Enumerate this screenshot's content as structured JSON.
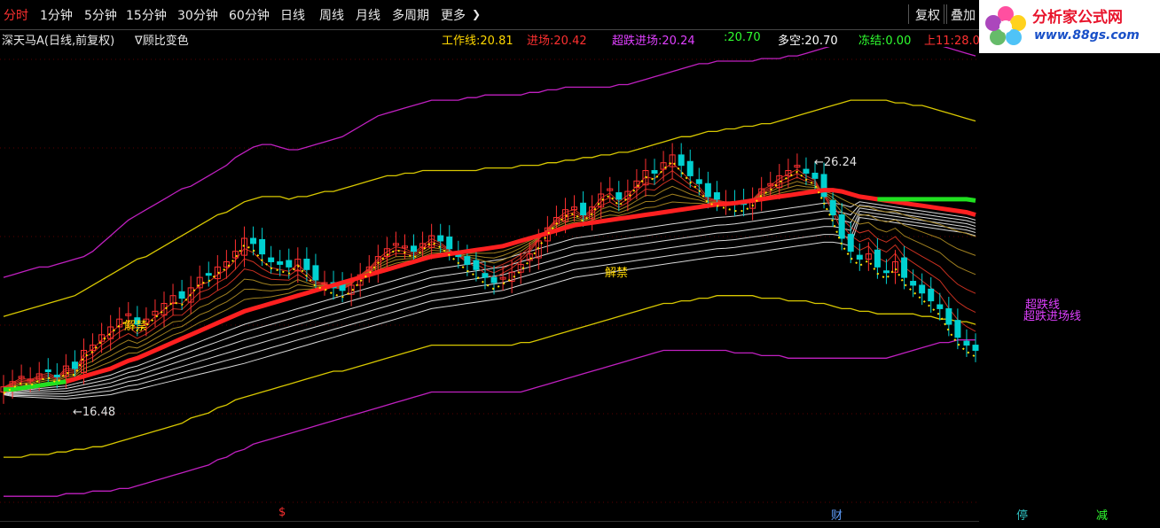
{
  "toolbar": {
    "tabs": [
      "分时",
      "1分钟",
      "5分钟",
      "15分钟",
      "30分钟",
      "60分钟",
      "日线",
      "周线",
      "月线",
      "多周期",
      "更多"
    ],
    "active_tab": "分时",
    "more_arrow": "❯",
    "right_buttons": [
      "复权",
      "叠加"
    ]
  },
  "logo": {
    "name": "分析家公式网",
    "url": "www.88gs.com"
  },
  "info": {
    "stock_title": "深天马A(日线,前复权)",
    "formula": "∇顾比变色",
    "items": [
      {
        "label": "工作线:",
        "value": "20.81",
        "color": "#ffd700"
      },
      {
        "label": "进场:",
        "value": "20.42",
        "color": "#ff3030"
      },
      {
        "label": "超跌进场:",
        "value": "20.24",
        "color": "#e040ff"
      },
      {
        "label": ":",
        "value": "20.70",
        "color": "#30ff30"
      },
      {
        "label": "多空:",
        "value": "20.70",
        "color": "#ffffff"
      },
      {
        "label": "冻结:",
        "value": "0.00",
        "color": "#30ff30"
      },
      {
        "label": "上11:",
        "value": "28.0",
        "color": "#ff3030"
      }
    ]
  },
  "annotations": {
    "high_label": "26.24",
    "low_label": "16.48",
    "jiejin_1": "解禁",
    "jiejin_2": "解禁",
    "chaodie_1": "超跌线",
    "chaodie_2": "超跌进场线"
  },
  "bottom_markers": [
    {
      "text": "$",
      "color": "#ff3030"
    },
    {
      "text": "财",
      "color": "#60a0ff"
    },
    {
      "text": "停",
      "color": "#30c0c0"
    },
    {
      "text": "减",
      "color": "#30ff30"
    }
  ],
  "footer": {
    "text": ""
  },
  "chart_data": {
    "type": "line",
    "note_colors": {
      "up": "#ff3030",
      "down": "#00d0d0",
      "work": "#ff2020",
      "green": "#20e020",
      "band_outer": "#c020c0",
      "band_inner": "#d8c800"
    },
    "ylim": [
      12.5,
      29.5
    ],
    "x": [
      0,
      1,
      2,
      3,
      4,
      5,
      6,
      7,
      8,
      9,
      10,
      11,
      12,
      13,
      14,
      15,
      16,
      17,
      18,
      19,
      20,
      21,
      22,
      23,
      24,
      25,
      26,
      27,
      28,
      29,
      30,
      31,
      32,
      33,
      34,
      35,
      36,
      37,
      38,
      39,
      40,
      41,
      42,
      43,
      44,
      45,
      46,
      47,
      48,
      49,
      50,
      51,
      52,
      53,
      54,
      55,
      56,
      57,
      58,
      59,
      60,
      61,
      62,
      63,
      64,
      65,
      66,
      67,
      68,
      69,
      70,
      71,
      72,
      73,
      74,
      75,
      76,
      77,
      78,
      79,
      80,
      81,
      82,
      83,
      84,
      85,
      86,
      87,
      88,
      89,
      90,
      91,
      92,
      93,
      94,
      95,
      96,
      97,
      98,
      99,
      100,
      101,
      102,
      103,
      104,
      105,
      106,
      107,
      108,
      109
    ],
    "series": [
      {
        "name": "close",
        "values": [
          17.0,
          17.2,
          17.4,
          17.3,
          17.5,
          17.6,
          17.4,
          17.8,
          17.7,
          18.4,
          18.6,
          19.0,
          19.3,
          19.6,
          19.8,
          19.4,
          19.6,
          19.9,
          20.2,
          20.5,
          20.4,
          20.8,
          21.2,
          21.3,
          21.6,
          21.8,
          22.2,
          22.7,
          22.5,
          22.1,
          21.8,
          21.7,
          21.6,
          21.9,
          21.5,
          21.1,
          21.0,
          20.8,
          20.7,
          20.9,
          21.3,
          21.6,
          22.0,
          22.3,
          22.5,
          22.4,
          22.2,
          22.5,
          22.8,
          22.6,
          22.3,
          22.0,
          21.7,
          21.5,
          21.2,
          21.0,
          21.2,
          21.4,
          21.7,
          22.1,
          22.6,
          23.1,
          23.5,
          23.8,
          23.9,
          23.6,
          23.9,
          24.4,
          24.6,
          24.2,
          24.5,
          24.9,
          25.3,
          25.2,
          25.6,
          25.9,
          25.5,
          25.1,
          24.8,
          24.3,
          24.2,
          24.1,
          24.0,
          24.0,
          24.2,
          24.6,
          24.8,
          25.1,
          25.3,
          25.5,
          25.2,
          25.0,
          24.3,
          23.6,
          22.7,
          22.2,
          21.9,
          22.1,
          21.6,
          21.4,
          21.8,
          21.2,
          20.9,
          20.6,
          20.3,
          20.0,
          19.4,
          18.9,
          18.6,
          18.4
        ]
      },
      {
        "name": "work_line",
        "values": [
          16.9,
          16.9,
          16.95,
          17.0,
          17.05,
          17.1,
          17.15,
          17.2,
          17.3,
          17.4,
          17.5,
          17.6,
          17.7,
          17.85,
          18.0,
          18.1,
          18.25,
          18.4,
          18.55,
          18.7,
          18.85,
          19.0,
          19.15,
          19.3,
          19.45,
          19.6,
          19.75,
          19.9,
          20.0,
          20.1,
          20.2,
          20.3,
          20.4,
          20.5,
          20.6,
          20.7,
          20.8,
          20.9,
          21.0,
          21.1,
          21.2,
          21.3,
          21.4,
          21.5,
          21.6,
          21.7,
          21.8,
          21.9,
          22.0,
          22.05,
          22.1,
          22.15,
          22.2,
          22.25,
          22.3,
          22.35,
          22.4,
          22.5,
          22.6,
          22.7,
          22.8,
          22.9,
          23.0,
          23.1,
          23.2,
          23.25,
          23.3,
          23.35,
          23.4,
          23.45,
          23.5,
          23.55,
          23.6,
          23.65,
          23.7,
          23.75,
          23.8,
          23.85,
          23.9,
          23.95,
          24.0,
          24.02,
          24.05,
          24.1,
          24.15,
          24.2,
          24.25,
          24.3,
          24.35,
          24.4,
          24.45,
          24.5,
          24.55,
          24.55,
          24.5,
          24.4,
          24.3,
          24.25,
          24.2,
          24.15,
          24.1,
          24.05,
          24.0,
          23.95,
          23.9,
          23.85,
          23.8,
          23.75,
          23.7,
          23.6
        ]
      },
      {
        "name": "band_outer_upper",
        "values": [
          21.2,
          21.3,
          21.4,
          21.5,
          21.6,
          21.6,
          21.7,
          21.8,
          21.9,
          22.0,
          22.2,
          22.5,
          22.8,
          23.1,
          23.4,
          23.6,
          23.8,
          24.0,
          24.2,
          24.4,
          24.6,
          24.7,
          24.9,
          25.1,
          25.3,
          25.5,
          25.8,
          26.0,
          26.2,
          26.3,
          26.3,
          26.2,
          26.1,
          26.1,
          26.2,
          26.3,
          26.4,
          26.5,
          26.6,
          26.8,
          27.0,
          27.2,
          27.4,
          27.5,
          27.6,
          27.7,
          27.8,
          27.9,
          28.0,
          28.0,
          28.0,
          28.0,
          28.1,
          28.1,
          28.2,
          28.2,
          28.2,
          28.2,
          28.2,
          28.3,
          28.3,
          28.4,
          28.4,
          28.5,
          28.5,
          28.5,
          28.5,
          28.5,
          28.5,
          28.6,
          28.6,
          28.7,
          28.8,
          28.9,
          29.0,
          29.1,
          29.2,
          29.3,
          29.4,
          29.4,
          29.5,
          29.5,
          29.5,
          29.5,
          29.5,
          29.6,
          29.6,
          29.6,
          29.7,
          29.7,
          29.8,
          29.9,
          30.0,
          30.1,
          30.2,
          30.3,
          30.4,
          30.5,
          30.6,
          30.6,
          30.6,
          30.5,
          30.4,
          30.3,
          30.2,
          30.1,
          30.0,
          29.9,
          29.8,
          29.7
        ]
      },
      {
        "name": "band_inner_upper",
        "values": [
          19.7,
          19.8,
          19.9,
          20.0,
          20.1,
          20.2,
          20.3,
          20.4,
          20.5,
          20.7,
          20.9,
          21.1,
          21.3,
          21.5,
          21.7,
          21.9,
          22.0,
          22.2,
          22.4,
          22.6,
          22.8,
          23.0,
          23.2,
          23.4,
          23.6,
          23.7,
          23.9,
          24.1,
          24.2,
          24.3,
          24.3,
          24.3,
          24.2,
          24.3,
          24.3,
          24.4,
          24.5,
          24.5,
          24.6,
          24.7,
          24.8,
          24.9,
          25.0,
          25.1,
          25.1,
          25.2,
          25.2,
          25.3,
          25.3,
          25.3,
          25.3,
          25.3,
          25.3,
          25.3,
          25.4,
          25.4,
          25.4,
          25.4,
          25.5,
          25.5,
          25.5,
          25.6,
          25.6,
          25.7,
          25.7,
          25.8,
          25.8,
          25.9,
          25.9,
          26.0,
          26.0,
          26.1,
          26.2,
          26.3,
          26.4,
          26.5,
          26.6,
          26.6,
          26.7,
          26.8,
          26.8,
          26.9,
          26.9,
          27.0,
          27.0,
          27.1,
          27.1,
          27.2,
          27.3,
          27.4,
          27.5,
          27.6,
          27.7,
          27.8,
          27.9,
          28.0,
          28.0,
          28.0,
          28.0,
          28.0,
          27.9,
          27.9,
          27.8,
          27.8,
          27.7,
          27.6,
          27.5,
          27.4,
          27.3,
          27.2
        ]
      },
      {
        "name": "band_inner_lower",
        "values": [
          14.3,
          14.3,
          14.3,
          14.4,
          14.4,
          14.4,
          14.5,
          14.5,
          14.6,
          14.6,
          14.7,
          14.7,
          14.8,
          14.9,
          15.0,
          15.1,
          15.2,
          15.3,
          15.4,
          15.5,
          15.6,
          15.8,
          15.9,
          16.0,
          16.2,
          16.3,
          16.5,
          16.6,
          16.7,
          16.8,
          16.9,
          17.0,
          17.1,
          17.2,
          17.3,
          17.4,
          17.5,
          17.6,
          17.6,
          17.7,
          17.8,
          17.9,
          18.0,
          18.1,
          18.2,
          18.3,
          18.4,
          18.5,
          18.6,
          18.6,
          18.6,
          18.6,
          18.6,
          18.6,
          18.6,
          18.6,
          18.6,
          18.6,
          18.7,
          18.7,
          18.8,
          18.9,
          19.0,
          19.1,
          19.2,
          19.3,
          19.4,
          19.5,
          19.6,
          19.7,
          19.8,
          19.9,
          20.0,
          20.1,
          20.2,
          20.2,
          20.3,
          20.3,
          20.4,
          20.4,
          20.5,
          20.5,
          20.5,
          20.5,
          20.5,
          20.4,
          20.4,
          20.4,
          20.3,
          20.3,
          20.3,
          20.2,
          20.2,
          20.1,
          20.0,
          20.0,
          19.9,
          19.9,
          19.8,
          19.8,
          19.8,
          19.8,
          19.8,
          19.7,
          19.7,
          19.6,
          19.6,
          19.5,
          19.5,
          19.4
        ]
      },
      {
        "name": "band_outer_lower",
        "values": [
          12.8,
          12.8,
          12.8,
          12.8,
          12.8,
          12.8,
          12.8,
          12.9,
          12.9,
          12.9,
          13.0,
          13.0,
          13.0,
          13.1,
          13.1,
          13.2,
          13.3,
          13.4,
          13.5,
          13.6,
          13.7,
          13.8,
          13.9,
          14.0,
          14.2,
          14.3,
          14.5,
          14.6,
          14.8,
          14.9,
          15.0,
          15.1,
          15.2,
          15.3,
          15.4,
          15.5,
          15.6,
          15.7,
          15.8,
          15.9,
          16.0,
          16.1,
          16.2,
          16.3,
          16.4,
          16.5,
          16.6,
          16.7,
          16.8,
          16.8,
          16.8,
          16.8,
          16.8,
          16.8,
          16.8,
          16.8,
          16.8,
          16.8,
          16.8,
          16.9,
          17.0,
          17.1,
          17.2,
          17.3,
          17.4,
          17.5,
          17.6,
          17.7,
          17.8,
          17.9,
          18.0,
          18.1,
          18.2,
          18.3,
          18.4,
          18.4,
          18.4,
          18.4,
          18.4,
          18.4,
          18.4,
          18.4,
          18.3,
          18.3,
          18.3,
          18.2,
          18.2,
          18.2,
          18.1,
          18.1,
          18.1,
          18.1,
          18.1,
          18.1,
          18.1,
          18.1,
          18.1,
          18.1,
          18.1,
          18.1,
          18.2,
          18.3,
          18.4,
          18.5,
          18.6,
          18.7,
          18.7,
          18.8,
          18.8,
          18.8
        ]
      }
    ]
  }
}
